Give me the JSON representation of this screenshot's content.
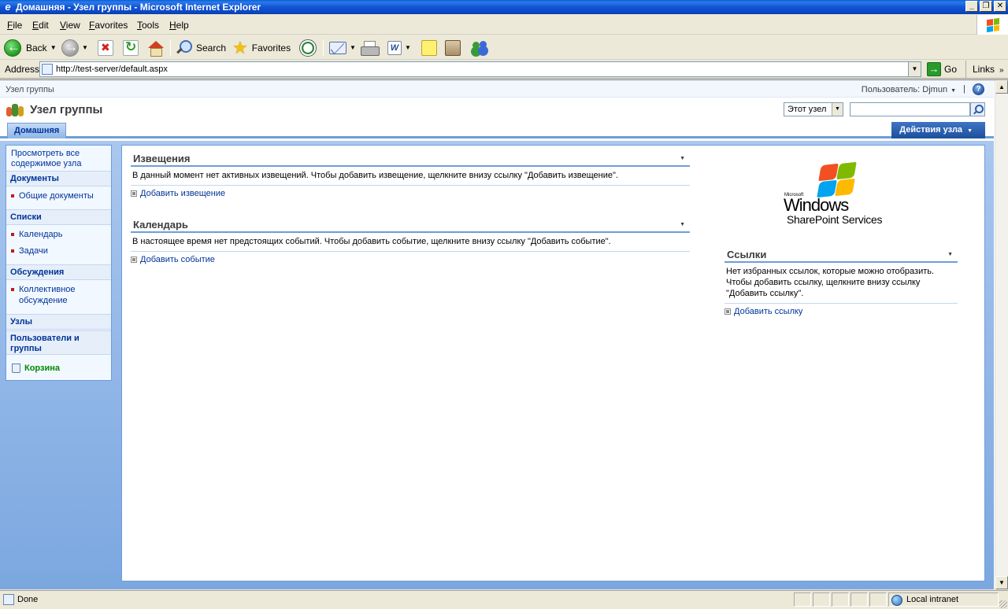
{
  "window": {
    "title": "Домашняя - Узел группы - Microsoft Internet Explorer",
    "controls": {
      "minimize": "_",
      "maximize": "❐",
      "close": "✕"
    }
  },
  "menubar": {
    "items": [
      "File",
      "Edit",
      "View",
      "Favorites",
      "Tools",
      "Help"
    ]
  },
  "toolbar": {
    "back_label": "Back",
    "search_label": "Search",
    "favorites_label": "Favorites"
  },
  "address": {
    "label": "Address",
    "url": "http://test-server/default.aspx",
    "go_label": "Go",
    "links_label": "Links"
  },
  "sharepoint": {
    "breadcrumb": "Узел группы",
    "user_label": "Пользователь: Djmun",
    "help_glyph": "?",
    "site_title": "Узел группы",
    "search_scope": "Этот узел",
    "search_value": "",
    "home_tab": "Домашняя",
    "site_actions": "Действия узла",
    "quicklaunch": {
      "view_all": "Просмотреть все содержимое узла",
      "documents_heading": "Документы",
      "documents_items": [
        "Общие документы"
      ],
      "lists_heading": "Списки",
      "lists_items": [
        "Календарь",
        "Задачи"
      ],
      "discussions_heading": "Обсуждения",
      "discussions_items": [
        "Коллективное обсуждение"
      ],
      "sites_heading": "Узлы",
      "people_heading": "Пользователи и группы",
      "recycle_bin": "Корзина"
    },
    "announcements": {
      "title": "Извещения",
      "empty_text": "В данный момент нет активных извещений. Чтобы добавить извещение, щелкните внизу ссылку \"Добавить извещение\".",
      "add_link": "Добавить извещение"
    },
    "calendar": {
      "title": "Календарь",
      "empty_text": "В настоящее время нет предстоящих событий. Чтобы добавить событие, щелкните внизу ссылку \"Добавить событие\".",
      "add_link": "Добавить событие"
    },
    "logo": {
      "microsoft": "Microsoft",
      "windows": "Windows",
      "product": "SharePoint Services"
    },
    "links": {
      "title": "Ссылки",
      "empty_text": "Нет избранных ссылок, которые можно отобразить. Чтобы добавить ссылку, щелкните внизу ссылку \"Добавить ссылку\".",
      "add_link": "Добавить ссылку"
    }
  },
  "statusbar": {
    "text": "Done",
    "zone": "Local intranet"
  }
}
